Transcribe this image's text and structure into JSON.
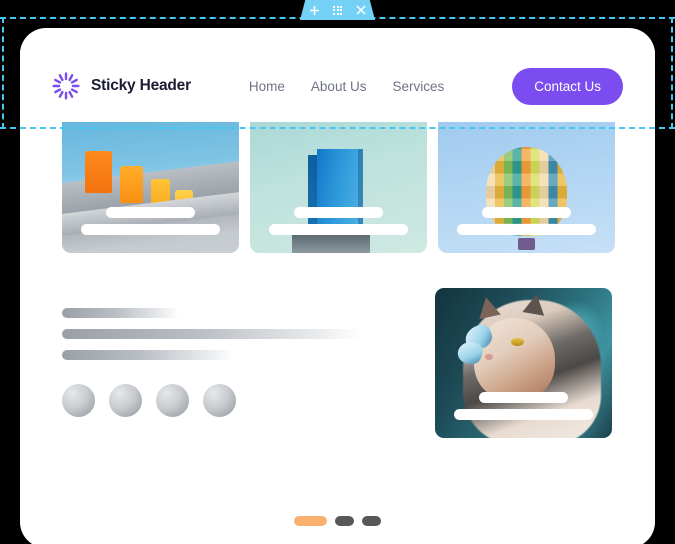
{
  "toolbar": {
    "add_label": "+",
    "apps_label": "apps",
    "close_label": "×",
    "color": "#74d0f5"
  },
  "header": {
    "brand": "Sticky Header",
    "logo_icon": "sunburst-icon",
    "nav": [
      {
        "label": "Home"
      },
      {
        "label": "About Us"
      },
      {
        "label": "Services"
      }
    ],
    "cta_label": "Contact Us",
    "cta_color": "#7b4df0",
    "nav_color": "#6f7387"
  },
  "cards": [
    {
      "alt": "orange rooftop water tanks on a building against blue sky"
    },
    {
      "alt": "blue glass tower building against pale teal sky"
    },
    {
      "alt": "colorful checkered hot air balloon in a light blue sky"
    }
  ],
  "media_card": {
    "alt": "fluffy cat with a blue butterfly on its nose"
  },
  "skeleton": {
    "bars": [
      39,
      100,
      57
    ],
    "avatar_count": 4
  },
  "pagination": {
    "active_index": 0,
    "count": 3,
    "active_color": "#f9b070",
    "inactive_color": "#58585a"
  }
}
